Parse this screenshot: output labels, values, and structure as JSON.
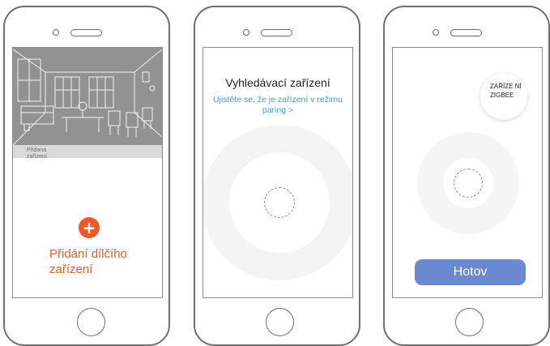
{
  "phones": [
    {
      "screen": "added-devices",
      "added_label": "Přidaná zařízení",
      "add_icon": "plus-icon",
      "add_label": "Přidání dílčího zařízení",
      "accent_color": "#f0582a"
    },
    {
      "screen": "searching",
      "title": "Vyhledávací zařízení",
      "link": "Ujistěte se, že je zařízení v režimu paring >",
      "link_color": "#3f9ddb"
    },
    {
      "screen": "found",
      "device_label": "ZAŘÍZE NÍ ZIGBEE",
      "done_label": "Hotov",
      "button_color": "#6a89d0"
    }
  ]
}
